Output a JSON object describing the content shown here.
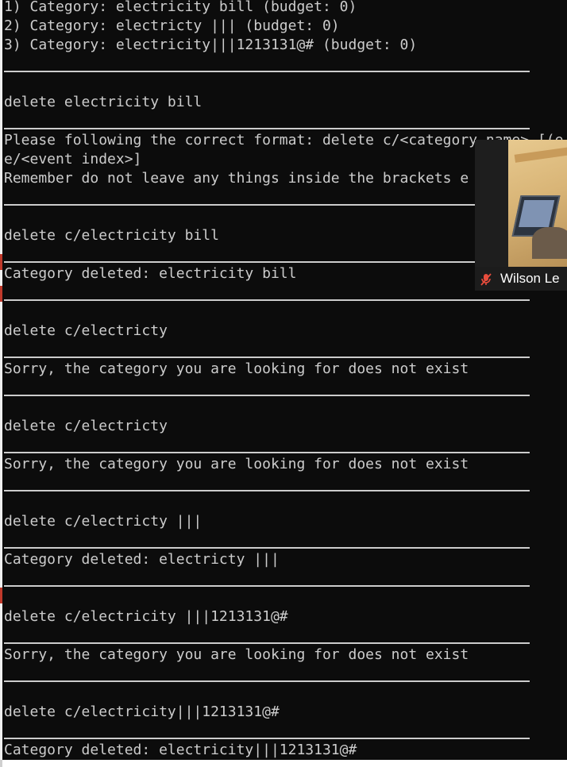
{
  "terminal": {
    "lines": [
      "1) Category: electricity bill (budget: 0)",
      "2) Category: electricty ||| (budget: 0)",
      "3) Category: electricity|||1213131@# (budget: 0)",
      "delete electricity bill",
      "Please following the correct format: delete c/<category_name> [(e",
      "e/<event index>]",
      "Remember do not leave any things inside the brackets e",
      "delete c/electricity bill",
      "Category deleted: electricity bill",
      "delete c/electricty",
      "Sorry, the category you are looking for does not exist",
      "delete c/electricty",
      "Sorry, the category you are looking for does not exist",
      "delete c/electricty |||",
      "Category deleted: electricty |||",
      "delete c/electricity |||1213131@#",
      "Sorry, the category you are looking for does not exist",
      "delete c/electricity|||1213131@#",
      "Category deleted: electricity|||1213131@#"
    ]
  },
  "video_overlay": {
    "participant_name": "Wilson Le",
    "mic_icon": "mic-muted-icon",
    "mic_color": "#e74c3c"
  },
  "colors": {
    "terminal_background": "#0c0c0c",
    "terminal_text": "#cccccc"
  }
}
